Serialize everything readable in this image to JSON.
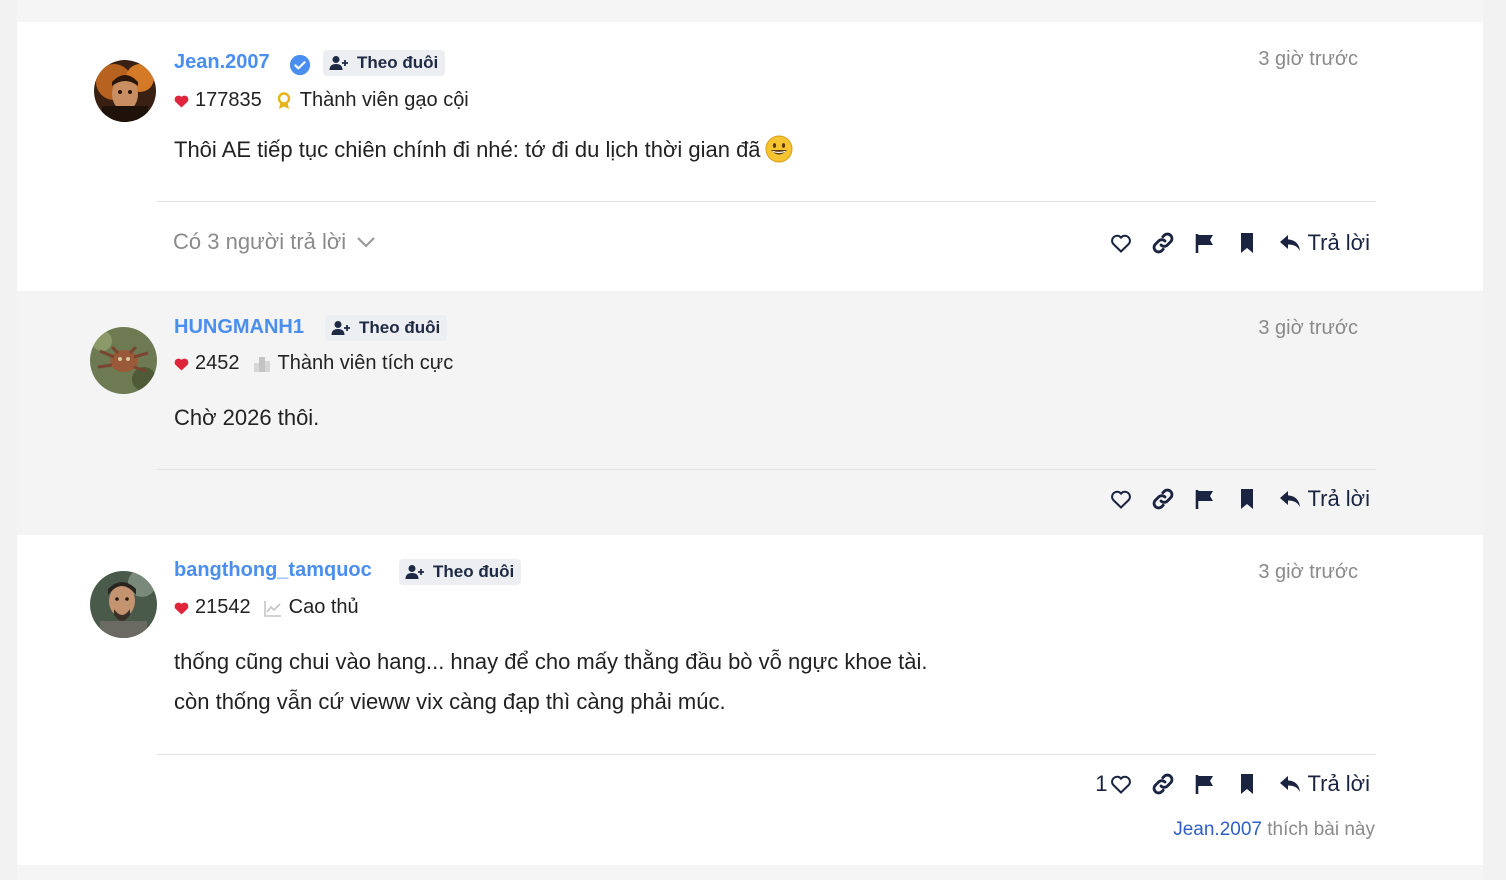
{
  "posts": [
    {
      "username": "Jean.2007",
      "verified": true,
      "follow_label": "Theo đuôi",
      "time": "3 giờ trước",
      "likes": "177835",
      "rank": "Thành viên gạo cội",
      "rank_icon": "award-ribbon-icon",
      "content_lines": [
        "Thôi AE tiếp tục chiên chính đi nhé: tớ đi du lịch thời gian đã"
      ],
      "emoji": "grinning-face-emoji",
      "replies_label": "Có 3 người trả lời",
      "reply_label": "Trả lời",
      "like_count": ""
    },
    {
      "username": "HUNGMANH1",
      "verified": false,
      "follow_label": "Theo đuôi",
      "time": "3 giờ trước",
      "likes": "2452",
      "rank": "Thành viên tích cực",
      "rank_icon": "building-icon",
      "content_lines": [
        "Chờ 2026 thôi."
      ],
      "reply_label": "Trả lời",
      "like_count": ""
    },
    {
      "username": "bangthong_tamquoc",
      "verified": false,
      "follow_label": "Theo đuôi",
      "time": "3 giờ trước",
      "likes": "21542",
      "rank": "Cao thủ",
      "rank_icon": "chart-line-icon",
      "content_lines": [
        "thống cũng chui vào hang... hnay để cho mấy thằng đầu bò vỗ ngực khoe tài.",
        "còn thống vẫn cứ vieww vix càng đạp thì càng phải múc."
      ],
      "reply_label": "Trả lời",
      "like_count": "1",
      "likers": {
        "name": "Jean.2007",
        "suffix": " thích bài này"
      }
    }
  ],
  "colors": {
    "username": "#4a8ef0",
    "heart": "#e0243c",
    "icon_dark": "#1a2440",
    "muted": "#8a8a8a"
  }
}
